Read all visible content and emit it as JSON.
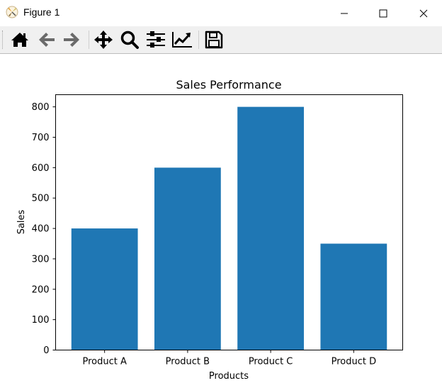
{
  "window": {
    "title": "Figure 1",
    "app_icon": "matplotlib-icon",
    "controls": [
      "minimize-icon",
      "maximize-icon",
      "close-icon"
    ]
  },
  "toolbar": {
    "buttons": [
      {
        "name": "home",
        "icon": "home-icon",
        "tooltip": "Reset original view"
      },
      {
        "name": "back",
        "icon": "arrow-left-icon",
        "tooltip": "Back"
      },
      {
        "name": "forward",
        "icon": "arrow-right-icon",
        "tooltip": "Forward"
      },
      {
        "name": "pan",
        "icon": "move-icon",
        "tooltip": "Pan"
      },
      {
        "name": "zoom",
        "icon": "magnifier-icon",
        "tooltip": "Zoom"
      },
      {
        "name": "subplots",
        "icon": "sliders-icon",
        "tooltip": "Configure subplots"
      },
      {
        "name": "customize",
        "icon": "line-chart-icon",
        "tooltip": "Edit axis"
      },
      {
        "name": "save",
        "icon": "floppy-disk-icon",
        "tooltip": "Save"
      }
    ]
  },
  "chart_data": {
    "type": "bar",
    "title": "Sales Performance",
    "xlabel": "Products",
    "ylabel": "Sales",
    "categories": [
      "Product A",
      "Product B",
      "Product C",
      "Product D"
    ],
    "values": [
      400,
      600,
      800,
      350
    ],
    "ylim": [
      0,
      840
    ],
    "yticks": [
      0,
      100,
      200,
      300,
      400,
      500,
      600,
      700,
      800
    ],
    "bar_color": "#1f77b4",
    "grid": false,
    "legend": "none"
  }
}
